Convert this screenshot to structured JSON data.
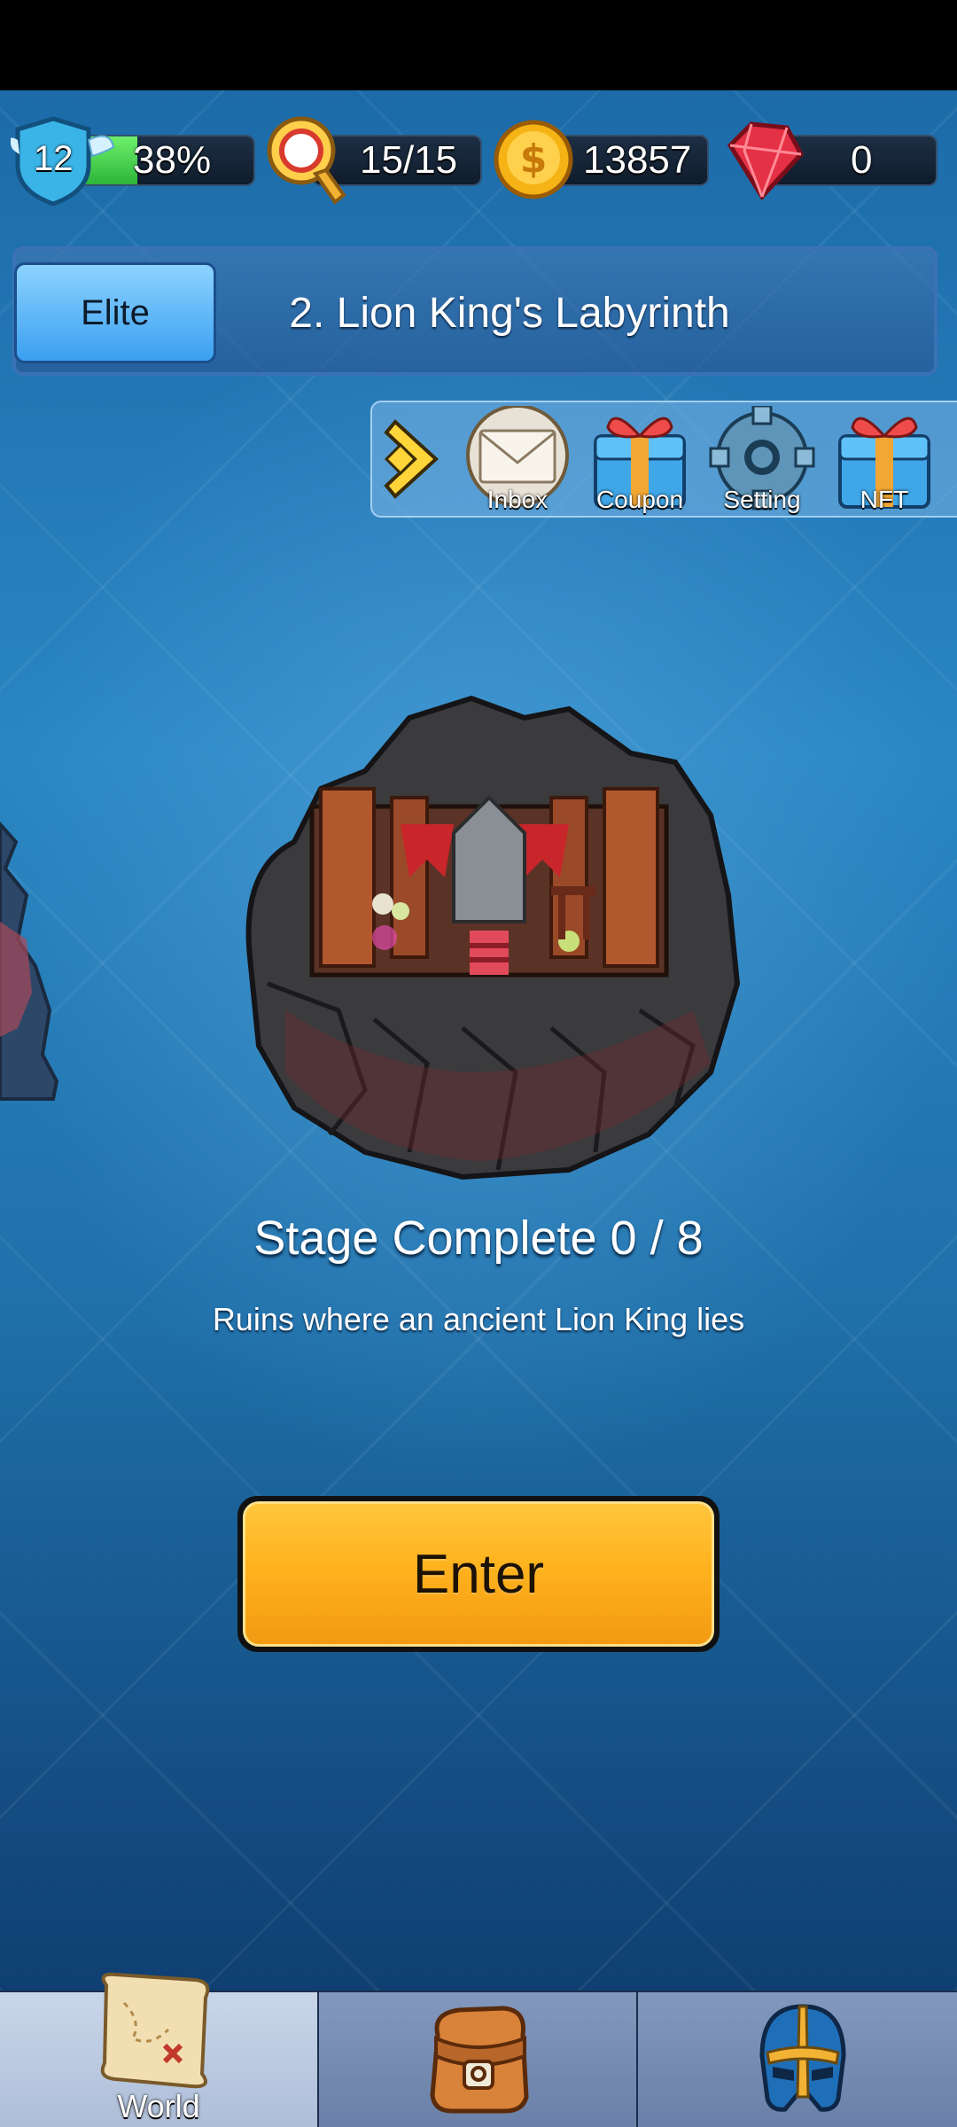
{
  "resources": {
    "level": "12",
    "xp_percent": "38%",
    "xp_fraction": 0.38,
    "keys": "15/15",
    "gold": "13857",
    "rubies": "0"
  },
  "header": {
    "difficulty_label": "Elite",
    "stage_title": "2. Lion King's Labyrinth"
  },
  "menu": {
    "items": [
      {
        "label": "Inbox",
        "icon": "envelope-icon"
      },
      {
        "label": "Coupon",
        "icon": "gift-icon"
      },
      {
        "label": "Setting",
        "icon": "gear-icon"
      },
      {
        "label": "NFT",
        "icon": "gift-icon"
      }
    ]
  },
  "stage": {
    "complete_text": "Stage Complete 0 / 8",
    "description": "Ruins where an ancient Lion King lies",
    "enter_label": "Enter"
  },
  "nav": {
    "tabs": [
      {
        "label": "World",
        "icon": "map-scroll-icon",
        "active": true
      },
      {
        "label": "",
        "icon": "backpack-icon",
        "active": false
      },
      {
        "label": "",
        "icon": "helmet-icon",
        "active": false
      }
    ]
  },
  "colors": {
    "accent_orange": "#ffb21e",
    "elite_blue": "#3b9ff0",
    "xp_green": "#2db53a"
  }
}
